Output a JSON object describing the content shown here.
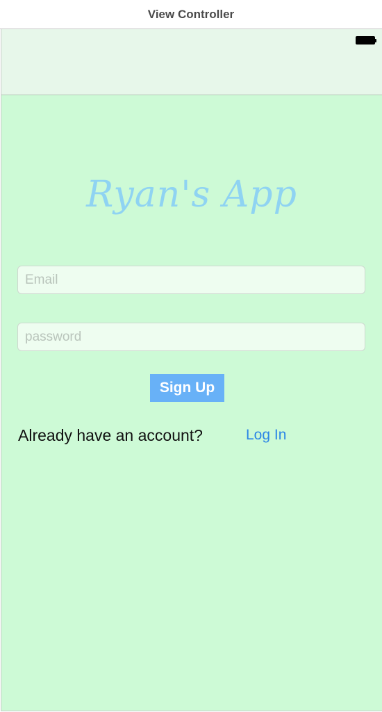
{
  "window": {
    "title": "View Controller"
  },
  "status_bar": {
    "battery_icon": "battery-full-icon"
  },
  "app": {
    "title": "Ryan's App"
  },
  "form": {
    "email_placeholder": "Email",
    "email_value": "",
    "password_placeholder": "password",
    "password_value": "",
    "signup_label": "Sign Up"
  },
  "footer": {
    "prompt": "Already have an account?",
    "login_label": "Log In"
  },
  "colors": {
    "background": "#cdfad6",
    "nav_background": "#e7f7ea",
    "title_color": "#8fd3f2",
    "button": "#68b1f7",
    "link": "#2c86e6"
  }
}
